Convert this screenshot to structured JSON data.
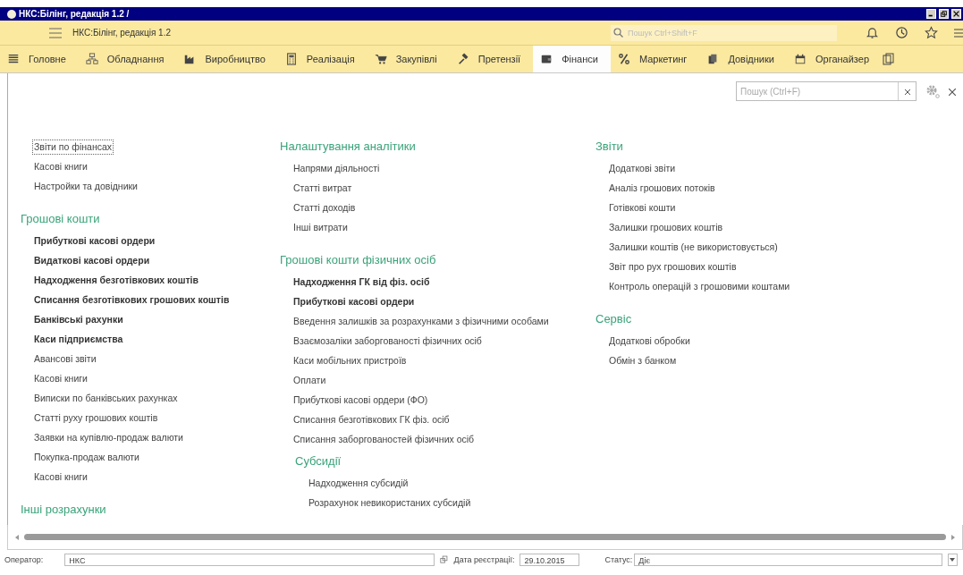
{
  "window": {
    "title": "НКС:Білінг, редакція 1.2 /"
  },
  "toolbar": {
    "title": "НКС:Білінг, редакція 1.2",
    "search": {
      "placeholder": "Пошук Ctrl+Shift+F"
    }
  },
  "sections": [
    {
      "label": "Головне",
      "selected": false
    },
    {
      "label": "Обладнання",
      "selected": false
    },
    {
      "label": "Виробництво",
      "selected": false
    },
    {
      "label": "Реалізація",
      "selected": false
    },
    {
      "label": "Закупівлі",
      "selected": false
    },
    {
      "label": "Претензії",
      "selected": false
    },
    {
      "label": "Фінанси",
      "selected": true
    },
    {
      "label": "Маркетинг",
      "selected": false
    },
    {
      "label": "Довідники",
      "selected": false
    },
    {
      "label": "Органайзер",
      "selected": false
    }
  ],
  "panel_search": {
    "placeholder": "Пошук (Ctrl+F)"
  },
  "columns": [
    {
      "groups": [
        {
          "items": [
            {
              "label": "Звіти по фінансах",
              "bold": false,
              "focused": true
            },
            {
              "label": "Касові книги",
              "bold": false,
              "focused": false
            },
            {
              "label": "Настройки та довідники",
              "bold": false,
              "focused": false
            }
          ]
        },
        {
          "heading": "Грошові кошти",
          "items": [
            {
              "label": "Прибуткові касові ордери",
              "bold": true,
              "focused": false
            },
            {
              "label": "Видаткові касові ордери",
              "bold": true,
              "focused": false
            },
            {
              "label": "Надходження безготівкових коштів",
              "bold": true,
              "focused": false
            },
            {
              "label": "Списання безготівкових грошових коштів",
              "bold": true,
              "focused": false
            },
            {
              "label": "Банківські рахунки",
              "bold": true,
              "focused": false
            },
            {
              "label": "Каси підприємства",
              "bold": true,
              "focused": false
            },
            {
              "label": "Авансові звіти",
              "bold": false,
              "focused": false
            },
            {
              "label": "Касові книги",
              "bold": false,
              "focused": false
            },
            {
              "label": "Виписки по банківських рахунках",
              "bold": false,
              "focused": false
            },
            {
              "label": "Статті руху грошових коштів",
              "bold": false,
              "focused": false
            },
            {
              "label": "Заявки на купівлю-продаж валюти",
              "bold": false,
              "focused": false
            },
            {
              "label": "Покупка-продаж валюти",
              "bold": false,
              "focused": false
            },
            {
              "label": "Касові книги",
              "bold": false,
              "focused": false
            }
          ]
        },
        {
          "heading": "Інші розрахунки"
        }
      ]
    },
    {
      "groups": [
        {
          "heading": "Налаштування аналітики",
          "items": [
            {
              "label": "Напрями діяльності",
              "bold": false,
              "focused": false
            },
            {
              "label": "Статті витрат",
              "bold": false,
              "focused": false
            },
            {
              "label": "Статті доходів",
              "bold": false,
              "focused": false
            },
            {
              "label": "Інші витрати",
              "bold": false,
              "focused": false
            }
          ]
        },
        {
          "heading": "Грошові кошти фізичних осіб",
          "items": [
            {
              "label": "Надходження ГК від фіз. осіб",
              "bold": true,
              "focused": false
            },
            {
              "label": "Прибуткові касові ордери",
              "bold": true,
              "focused": false
            },
            {
              "label": "Введення залишків за розрахунками з фізичними особами",
              "bold": false,
              "focused": false
            },
            {
              "label": "Взаємозаліки заборгованості фізичних осіб",
              "bold": false,
              "focused": false
            },
            {
              "label": "Каси мобільних пристроїв",
              "bold": false,
              "focused": false
            },
            {
              "label": "Оплати",
              "bold": false,
              "focused": false
            },
            {
              "label": "Прибуткові касові ордери (ФО)",
              "bold": false,
              "focused": false
            },
            {
              "label": "Списання безготівкових ГК фіз. осіб",
              "bold": false,
              "focused": false
            },
            {
              "label": "Списання заборгованостей фізичних осіб",
              "bold": false,
              "focused": false
            }
          ],
          "children": [
            {
              "heading": "Субсидії",
              "items": [
                {
                  "label": "Надходження субсидій",
                  "bold": false,
                  "focused": false
                },
                {
                  "label": "Розрахунок невикористаних субсидій",
                  "bold": false,
                  "focused": false
                }
              ]
            }
          ]
        }
      ]
    },
    {
      "groups": [
        {
          "heading": "Звіти",
          "items": [
            {
              "label": "Додаткові звіти",
              "bold": false,
              "focused": false
            },
            {
              "label": "Аналіз грошових потоків",
              "bold": false,
              "focused": false
            },
            {
              "label": "Готівкові кошти",
              "bold": false,
              "focused": false
            },
            {
              "label": "Залишки грошових коштів",
              "bold": false,
              "focused": false
            },
            {
              "label": "Залишки коштів (не використовується)",
              "bold": false,
              "focused": false
            },
            {
              "label": "Звіт про рух грошових коштів",
              "bold": false,
              "focused": false
            },
            {
              "label": "Контроль операцій з грошовими коштами",
              "bold": false,
              "focused": false
            }
          ]
        },
        {
          "heading": "Сервіс",
          "items": [
            {
              "label": "Додаткові обробки",
              "bold": false,
              "focused": false
            },
            {
              "label": "Обмін з банком",
              "bold": false,
              "focused": false
            }
          ]
        }
      ]
    }
  ],
  "status_bar": {
    "operator_label": "Оператор:",
    "operator": "НКС",
    "date_label": "Дата реєстрації:",
    "date": "29.10.2015",
    "status_label": "Статус:",
    "status": "Діє"
  }
}
